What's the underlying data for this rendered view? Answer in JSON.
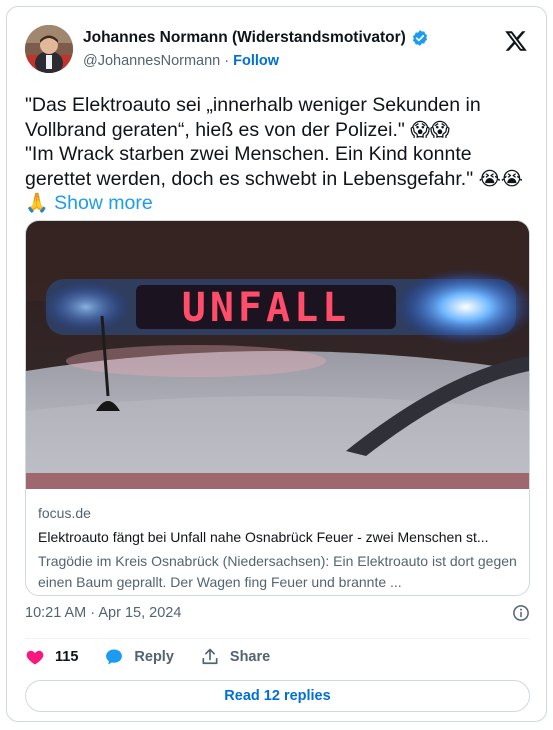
{
  "author": {
    "name": "Johannes Normann (Widerstandsmotivator)",
    "handle": "@JohannesNormann",
    "separator": "·",
    "follow_label": "Follow"
  },
  "tweet": {
    "line1": "\"Das Elektroauto sei „innerhalb weniger Sekunden in Vollbrand geraten“, hieß es von der Polizei.\"",
    "line1_emoji": "😱😱",
    "line2": "\"Im Wrack starben zwei Menschen. Ein Kind konnte gerettet werden, doch es schwebt in Lebensgefahr.\"",
    "line2_emoji": "😭😭🙏",
    "show_more": "Show more"
  },
  "media": {
    "sign_text": "UNFALL",
    "domain": "focus.de",
    "title": "Elektroauto fängt bei Unfall nahe Osnabrück Feuer - zwei Menschen st...",
    "description": "Tragödie im Kreis Osnabrück (Niedersachsen): Ein Elektroauto ist dort gegen einen Baum geprallt. Der Wagen fing Feuer und brannte ..."
  },
  "meta": {
    "timestamp": "10:21 AM · Apr 15, 2024"
  },
  "actions": {
    "likes": "115",
    "reply_label": "Reply",
    "share_label": "Share"
  },
  "read_replies_label": "Read 12 replies",
  "colors": {
    "accent": "#1d9bf0",
    "link": "#006fd6",
    "like": "#f91880",
    "muted": "#536471",
    "border": "#cfd9de"
  },
  "icons": [
    "x-logo-icon",
    "verified-badge-icon",
    "info-icon",
    "heart-icon",
    "reply-icon",
    "share-icon"
  ]
}
